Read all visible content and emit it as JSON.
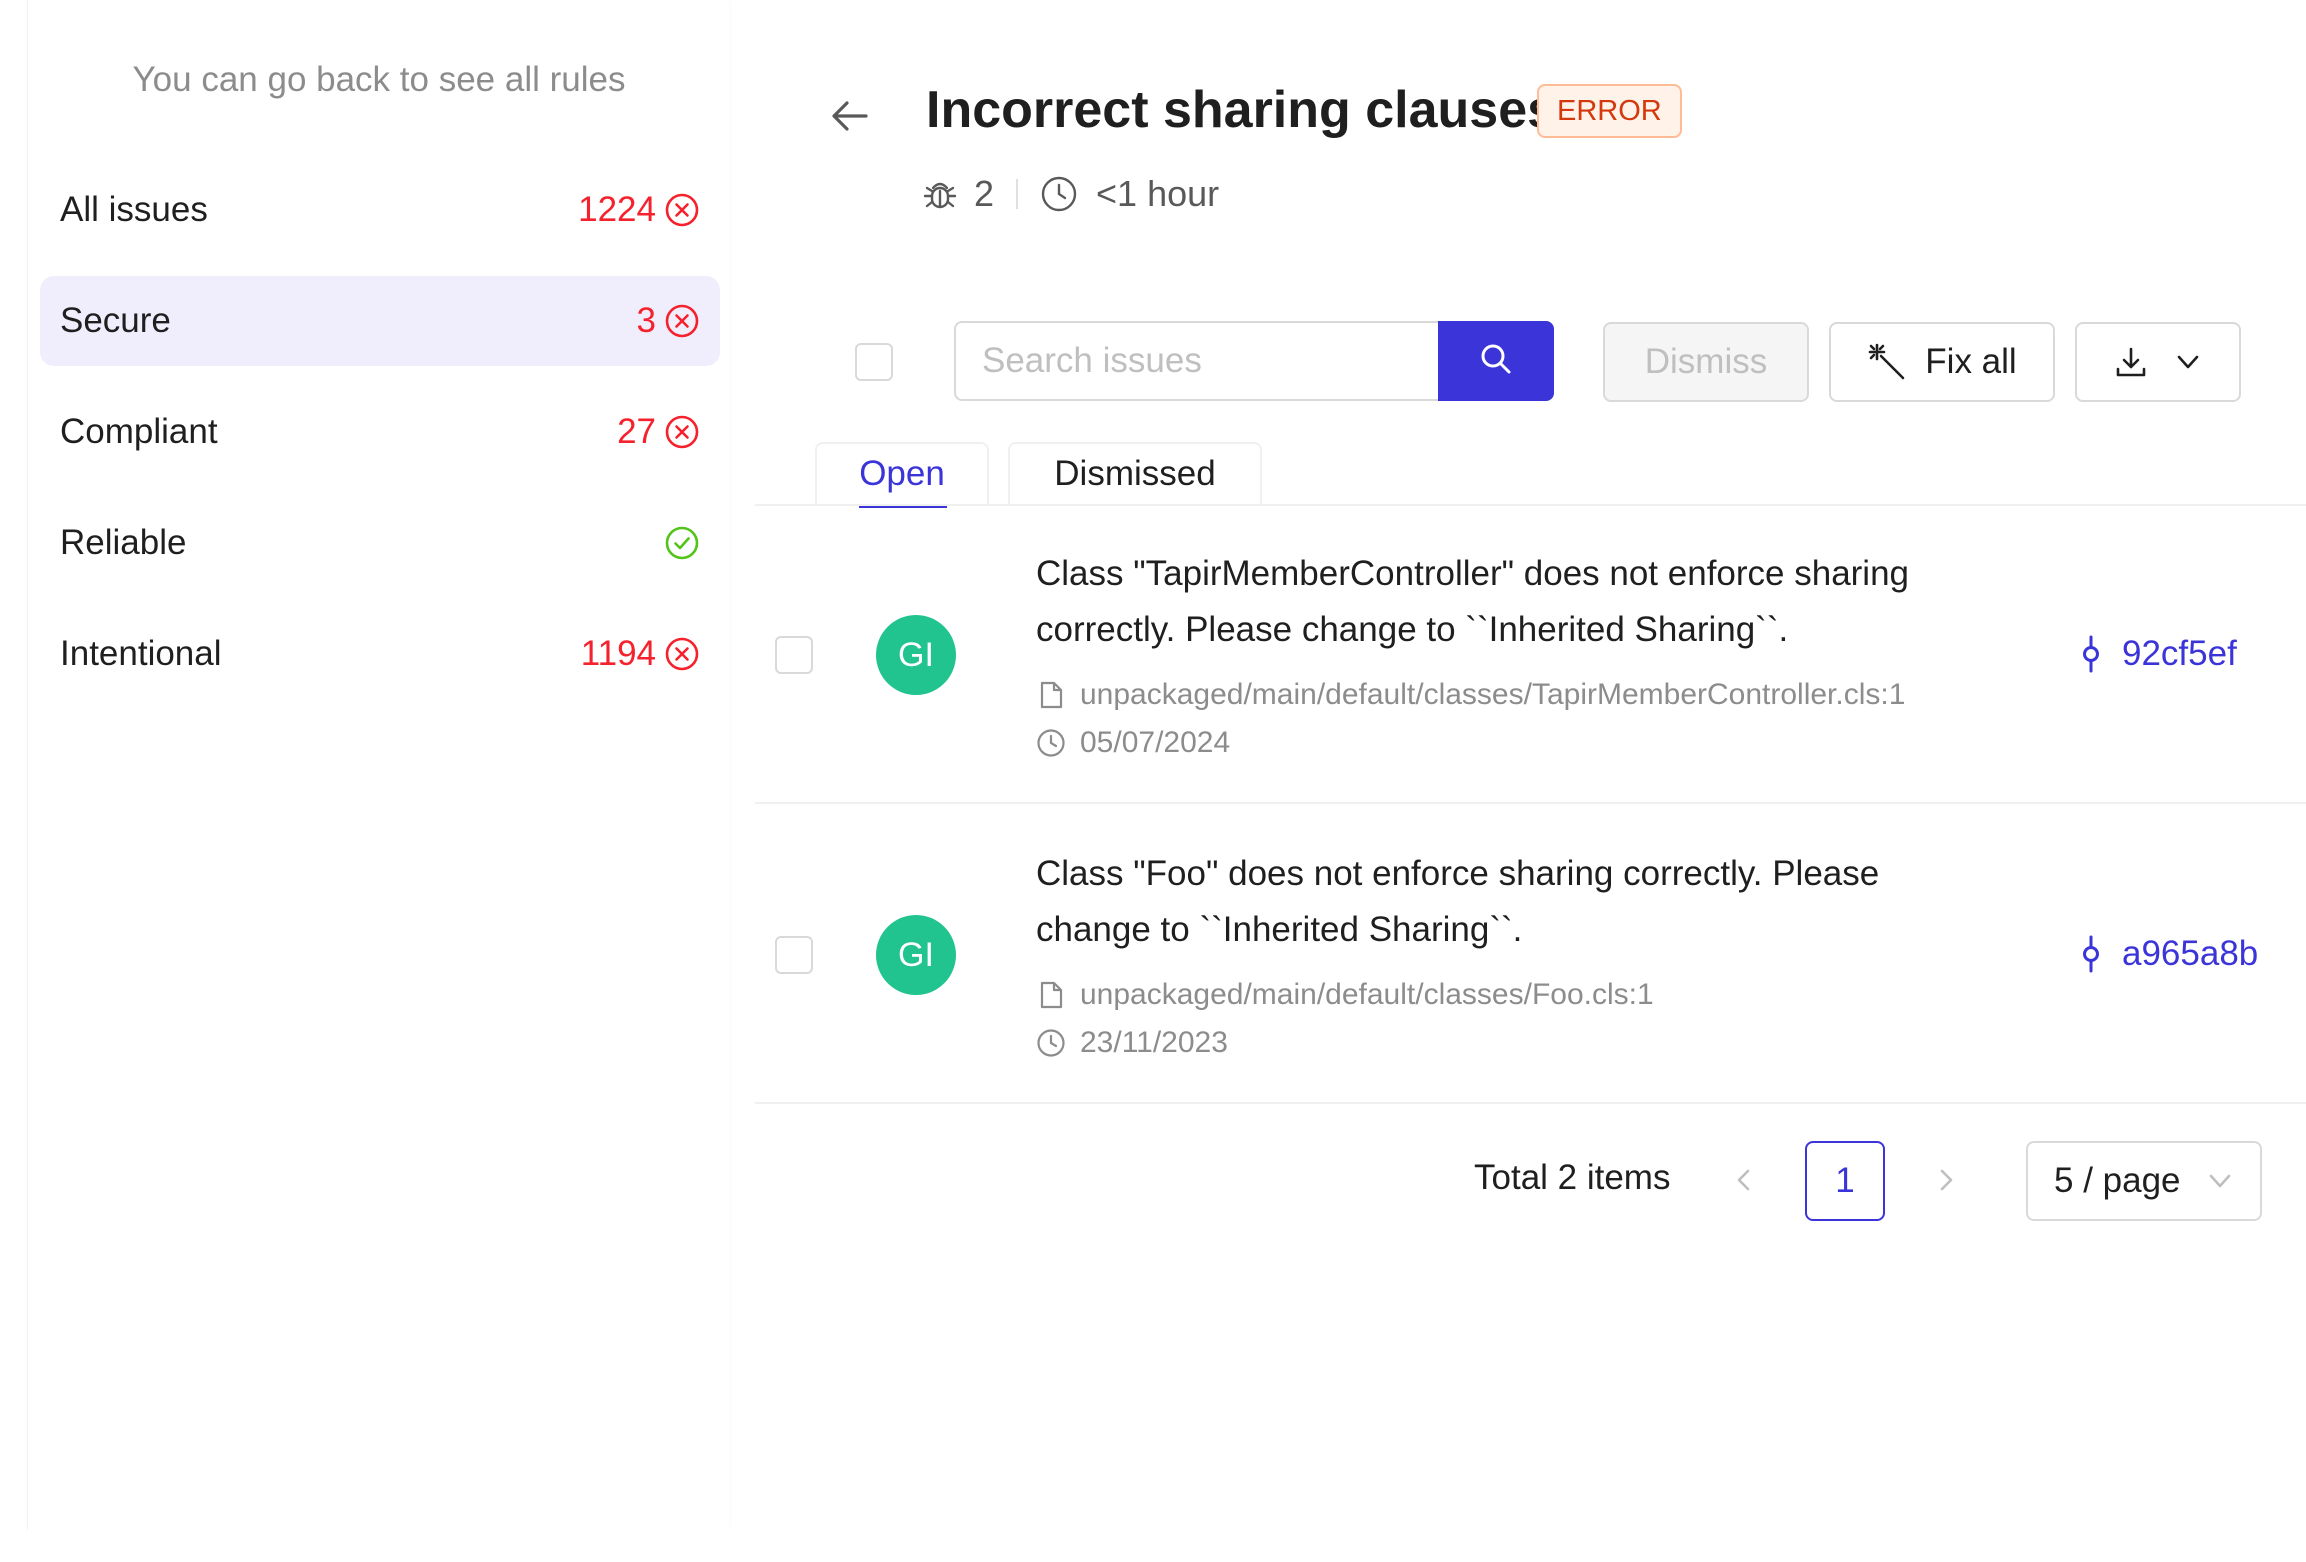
{
  "sidebar": {
    "back_hint": "You can go back to see all rules",
    "items": [
      {
        "label": "All issues",
        "count": "1224",
        "status": "error"
      },
      {
        "label": "Secure",
        "count": "3",
        "status": "error",
        "active": true
      },
      {
        "label": "Compliant",
        "count": "27",
        "status": "error"
      },
      {
        "label": "Reliable",
        "count": "",
        "status": "ok"
      },
      {
        "label": "Intentional",
        "count": "1194",
        "status": "error"
      }
    ]
  },
  "header": {
    "title": "Incorrect sharing clauses",
    "severity": "ERROR",
    "issue_count": "2",
    "effort": "<1 hour"
  },
  "toolbar": {
    "search_placeholder": "Search issues",
    "dismiss_label": "Dismiss",
    "fix_all_label": "Fix all"
  },
  "tabs": [
    {
      "label": "Open",
      "active": true
    },
    {
      "label": "Dismissed",
      "active": false
    }
  ],
  "issues": [
    {
      "avatar": "GI",
      "message": "Class \"TapirMemberController\" does not enforce sharing correctly. Please change to ``Inherited Sharing``.",
      "file": "unpackaged/main/default/classes/TapirMemberController.cls:1",
      "date": "05/07/2024",
      "commit": "92cf5ef"
    },
    {
      "avatar": "GI",
      "message": "Class \"Foo\" does not enforce sharing correctly. Please change to ``Inherited Sharing``.",
      "file": "unpackaged/main/default/classes/Foo.cls:1",
      "date": "23/11/2023",
      "commit": "a965a8b"
    }
  ],
  "pagination": {
    "total": "Total 2 items",
    "current_page": "1",
    "page_size": "5 / page"
  },
  "colors": {
    "accent": "#3b34d9",
    "error": "#f5222d",
    "success": "#52c41a",
    "avatar": "#21c38f",
    "active_bg": "#f0eefc"
  }
}
